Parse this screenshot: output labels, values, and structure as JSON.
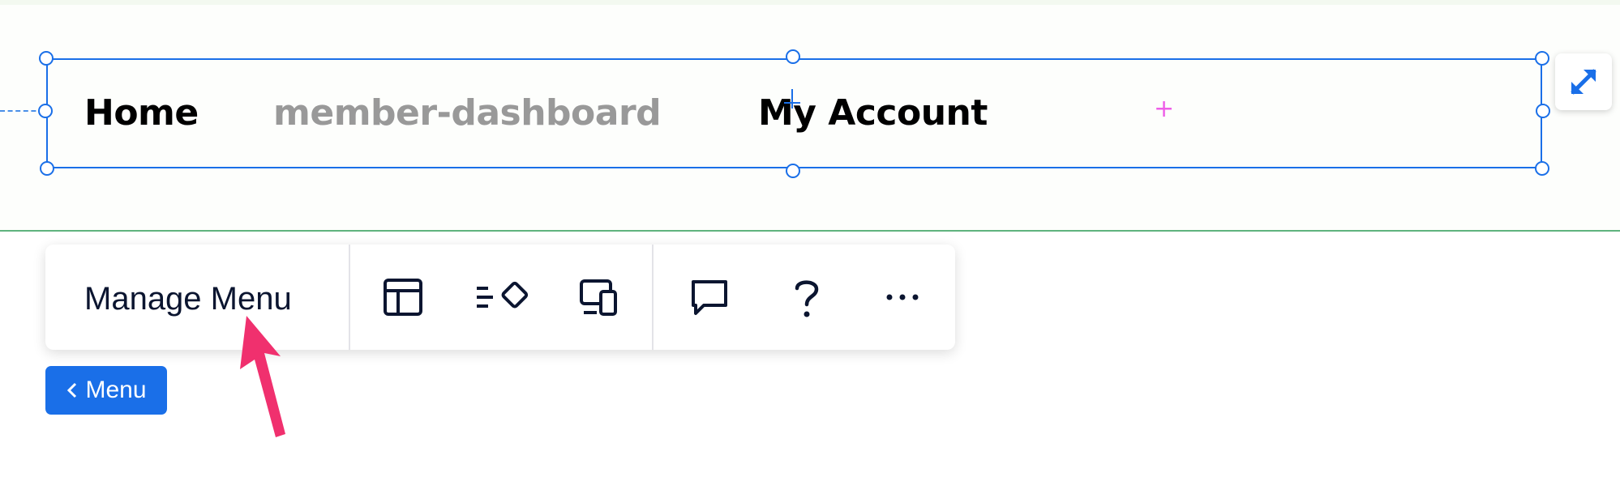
{
  "menu_items": [
    {
      "label": "Home",
      "muted": false
    },
    {
      "label": "member-dashboard",
      "muted": true
    },
    {
      "label": "My Account",
      "muted": false
    }
  ],
  "toolbar": {
    "manage_menu_label": "Manage Menu",
    "icons": [
      "layout-icon",
      "animation-icon",
      "devices-icon",
      "comment-icon",
      "help-icon",
      "more-icon"
    ]
  },
  "back_button": {
    "label": "Menu"
  },
  "colors": {
    "selection": "#1a6fe8",
    "add_marker": "#ee5ee8",
    "annotation_arrow": "#f0306e",
    "section_line": "#5fb37e",
    "muted_item": "#999999"
  }
}
